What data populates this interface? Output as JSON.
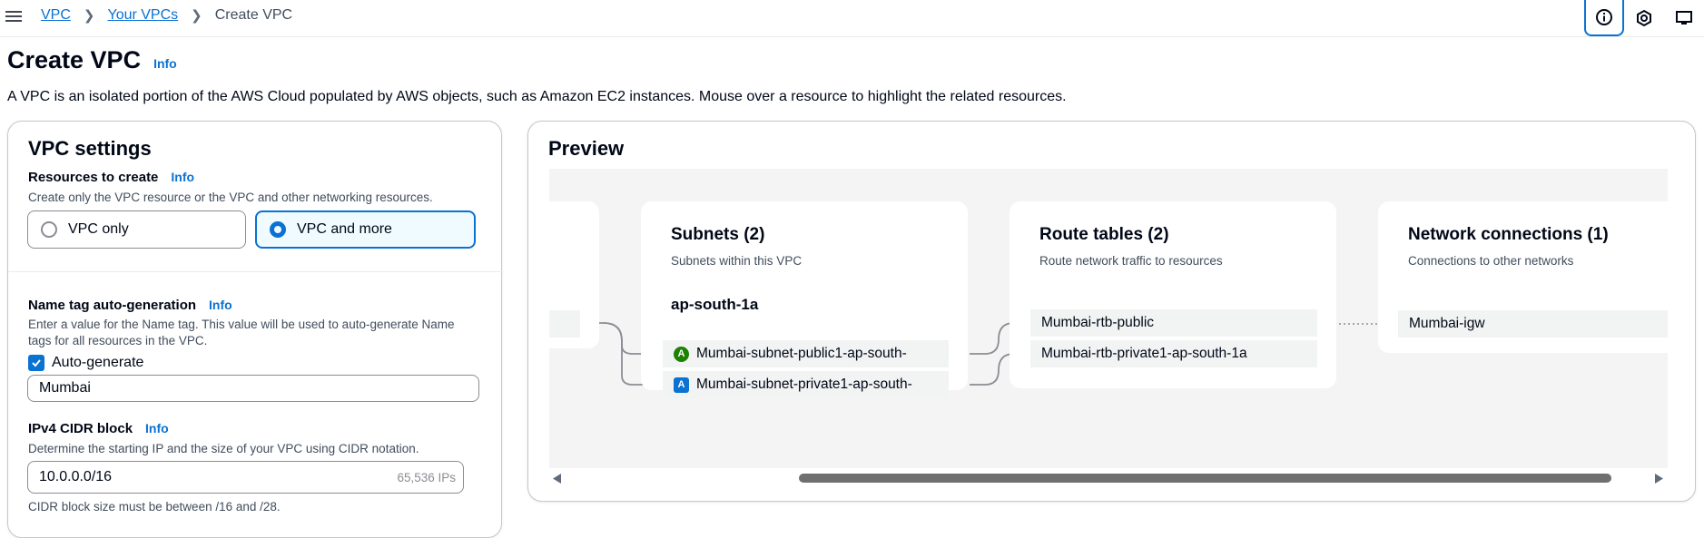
{
  "breadcrumb": {
    "item1": "VPC",
    "item2": "Your VPCs",
    "current": "Create VPC"
  },
  "tools": [
    "info-circle-icon",
    "settings-hex-icon",
    "screen-icon"
  ],
  "page": {
    "title": "Create VPC",
    "info": "Info",
    "description": "A VPC is an isolated portion of the AWS Cloud populated by AWS objects, such as Amazon EC2 instances. Mouse over a resource to highlight the related resources."
  },
  "vpc_settings": {
    "heading": "VPC settings",
    "resources": {
      "label": "Resources to create",
      "info": "Info",
      "help": "Create only the VPC resource or the VPC and other networking resources.",
      "option_vpc_only": "VPC only",
      "option_vpc_and_more": "VPC and more",
      "selected": "VPC and more"
    },
    "name_tag": {
      "label": "Name tag auto-generation",
      "info": "Info",
      "help_line1": "Enter a value for the Name tag. This value will be used to auto-generate Name",
      "help_line2": "tags for all resources in the VPC.",
      "checkbox_label": "Auto-generate",
      "checked": true,
      "value": "Mumbai"
    },
    "ipv4": {
      "label": "IPv4 CIDR block",
      "info": "Info",
      "help": "Determine the starting IP and the size of your VPC using CIDR notation.",
      "value": "10.0.0.0/16",
      "suffix": "65,536 IPs",
      "constraint": "CIDR block size must be between /16 and /28."
    }
  },
  "preview": {
    "heading": "Preview",
    "subnets": {
      "title": "Subnets (2)",
      "subtitle": "Subnets within this VPC",
      "az": "ap-south-1a",
      "items": [
        {
          "badge": "A",
          "badge_color": "#1d8102",
          "label": "Mumbai-subnet-public1-ap-south-"
        },
        {
          "badge": "A",
          "badge_color": "#0972d3",
          "label": "Mumbai-subnet-private1-ap-south-"
        }
      ]
    },
    "route_tables": {
      "title": "Route tables (2)",
      "subtitle": "Route network traffic to resources",
      "items": [
        "Mumbai-rtb-public",
        "Mumbai-rtb-private1-ap-south-1a"
      ]
    },
    "network": {
      "title": "Network connections (1)",
      "subtitle": "Connections to other networks",
      "items": [
        "Mumbai-igw"
      ]
    }
  },
  "colors": {
    "accent": "#0972d3",
    "public_badge": "#1d8102",
    "private_badge": "#0972d3"
  }
}
